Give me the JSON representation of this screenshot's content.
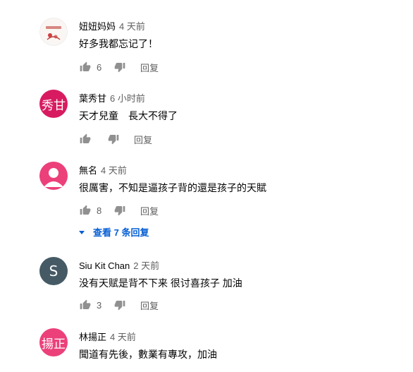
{
  "comments": [
    {
      "author": "妞妞妈妈",
      "time": "4 天前",
      "text": "好多我都忘记了！",
      "likes": "6",
      "reply_label": "回复",
      "avatar_icon": "photo-avatar"
    },
    {
      "author": "葉秀甘",
      "time": "6 小时前",
      "text": "天才兒童　長大不得了",
      "likes": "",
      "reply_label": "回复",
      "avatar_text": "秀甘"
    },
    {
      "author": "無名",
      "time": "4 天前",
      "text": "很厲害，不知是逼孩子背的還是孩子的天賦",
      "likes": "8",
      "reply_label": "回复",
      "avatar_icon": "person-avatar",
      "view_replies": "查看 7 条回复"
    },
    {
      "author": "Siu Kit Chan",
      "time": "2 天前",
      "text": "没有天赋是背不下来 很讨喜孩子 加油",
      "likes": "3",
      "reply_label": "回复",
      "avatar_text": "S"
    },
    {
      "author": "林揚正",
      "time": "4 天前",
      "text": "聞道有先後，數業有專攻，加油",
      "avatar_text": "揚正"
    }
  ],
  "colors": {
    "link_blue": "#065fd4",
    "secondary_text": "#606060",
    "icon_gray": "#909090"
  }
}
